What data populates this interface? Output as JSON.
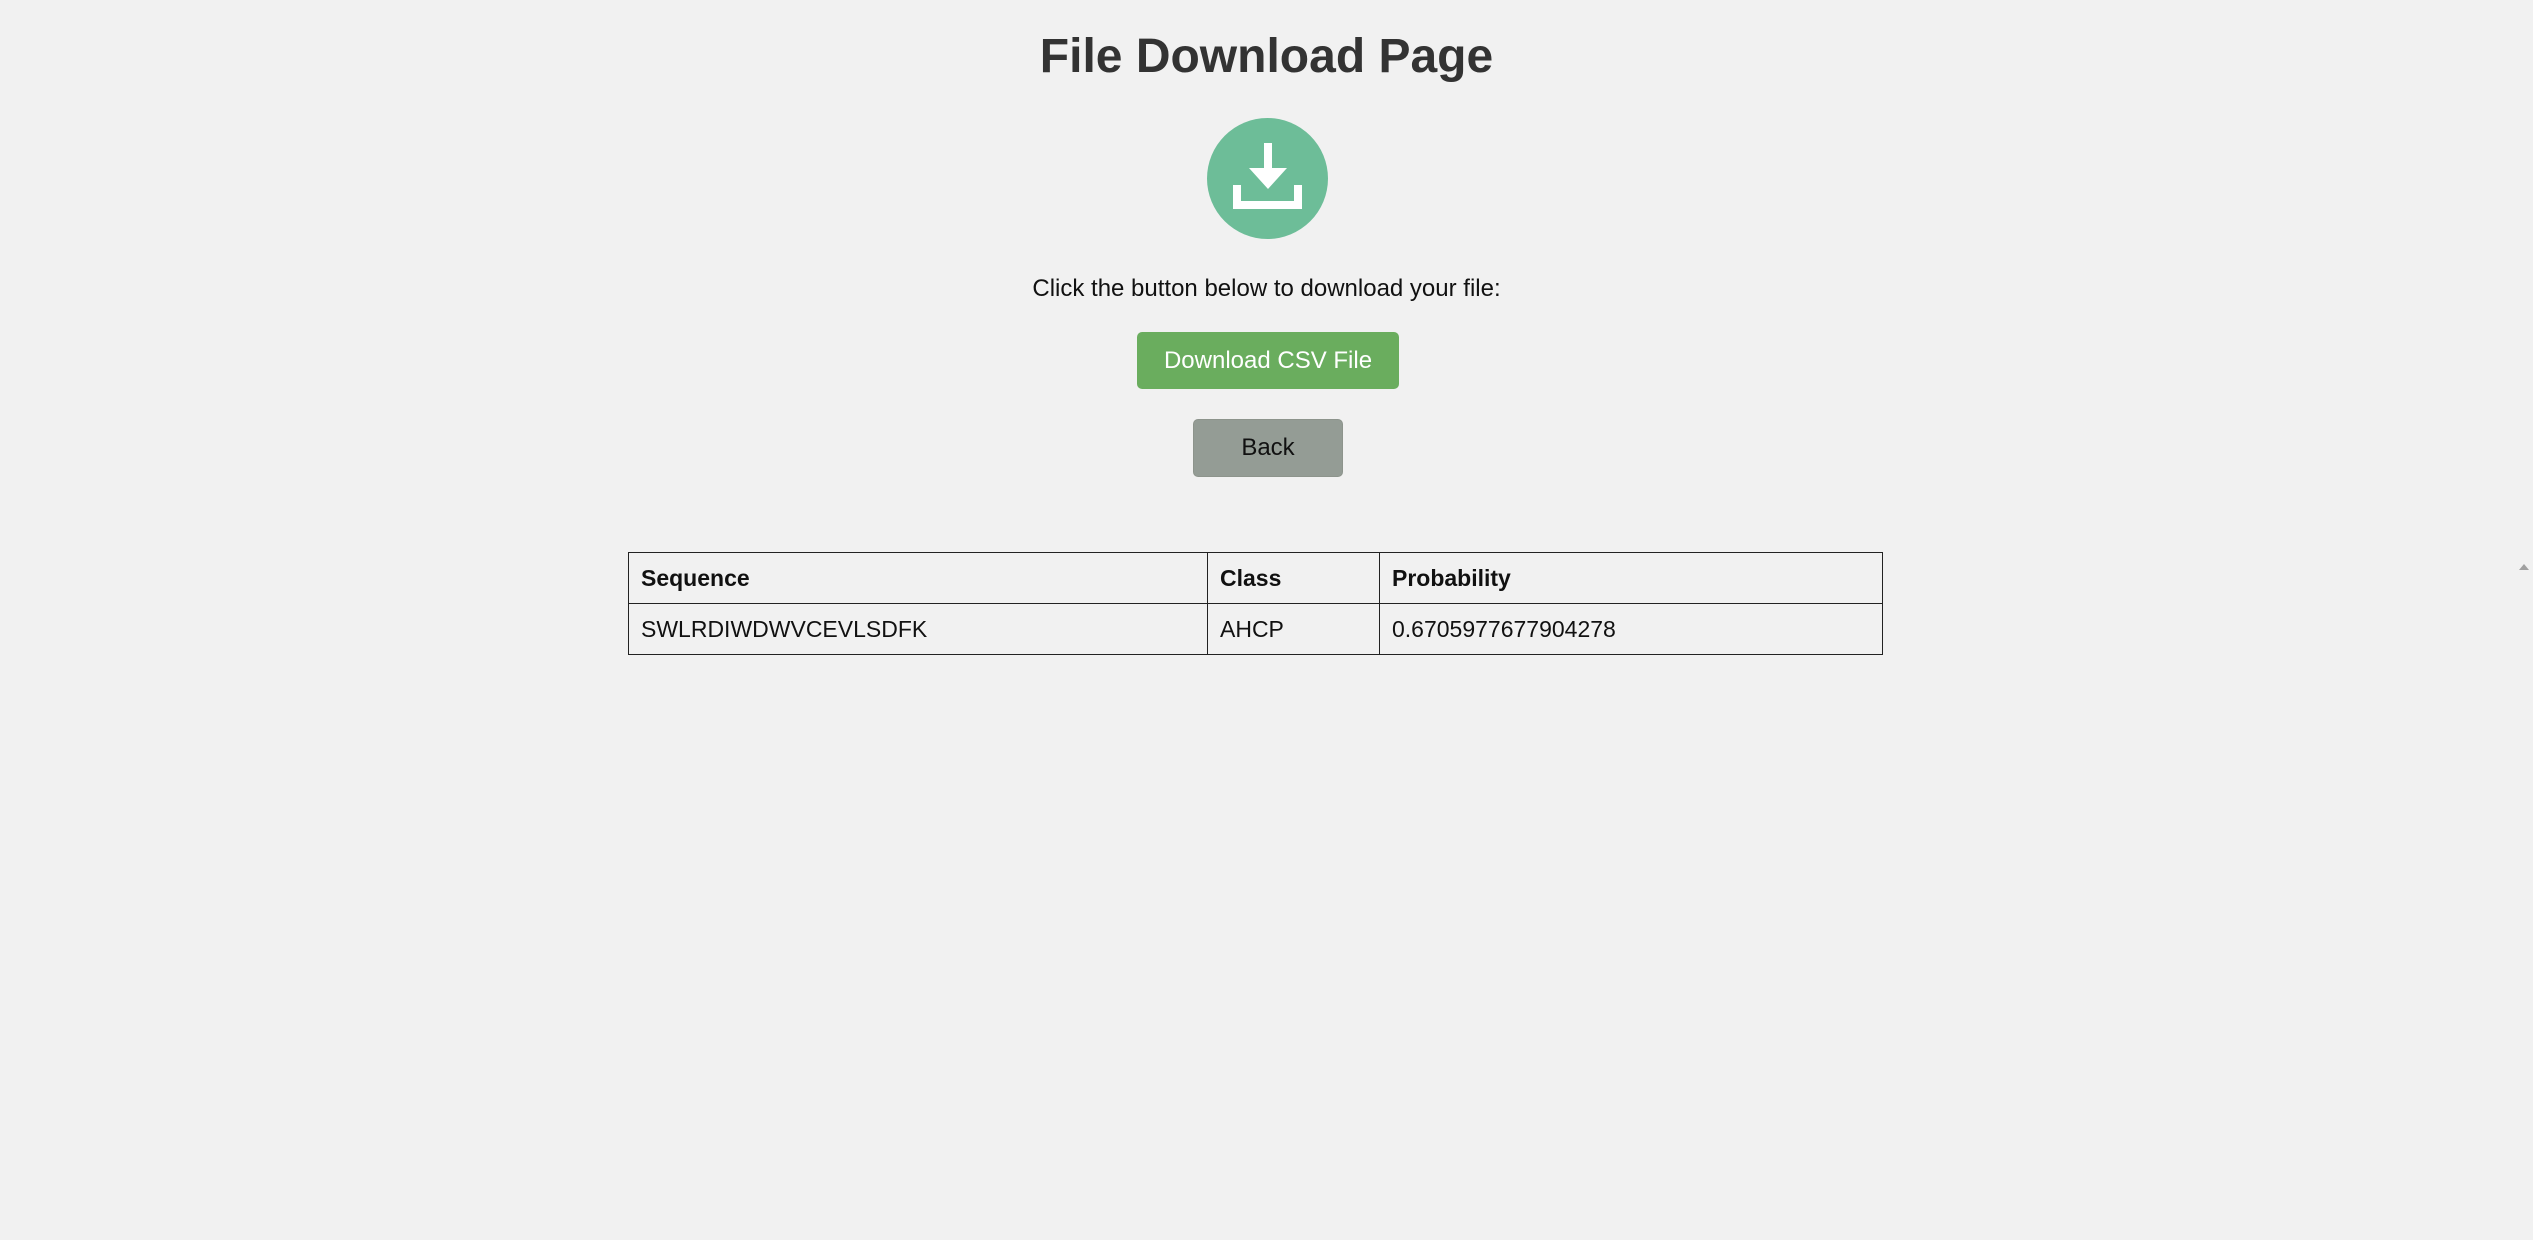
{
  "page": {
    "title": "File Download Page",
    "instruction": "Click the button below to download your file:"
  },
  "icons": {
    "download": "download-tray-icon",
    "scroll_up": "scroll-up-arrow-icon"
  },
  "buttons": {
    "download_label": "Download CSV File",
    "back_label": "Back"
  },
  "colors": {
    "download_circle": "#6dbd98",
    "download_button": "#6aad5e",
    "back_button": "#949c95",
    "background": "#f1f1f1"
  },
  "table": {
    "headers": [
      "Sequence",
      "Class",
      "Probability"
    ],
    "rows": [
      [
        "SWLRDIWDWVCEVLSDFK",
        "AHCP",
        "0.6705977677904278"
      ]
    ]
  }
}
